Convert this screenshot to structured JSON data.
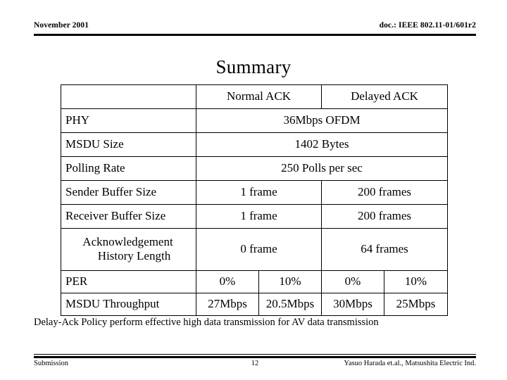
{
  "header": {
    "date": "November 2001",
    "doc_id": "doc.: IEEE 802.11-01/601r2"
  },
  "title": "Summary",
  "table": {
    "column_headers": [
      "",
      "Normal ACK",
      "Delayed ACK"
    ],
    "rows": [
      {
        "label": "PHY",
        "span": "all",
        "values": [
          "36Mbps OFDM"
        ]
      },
      {
        "label": "MSDU Size",
        "span": "all",
        "values": [
          "1402 Bytes"
        ]
      },
      {
        "label": "Polling Rate",
        "span": "all",
        "values": [
          "250 Polls per sec"
        ]
      },
      {
        "label": "Sender Buffer Size",
        "span": "two",
        "values": [
          "1 frame",
          "200 frames"
        ]
      },
      {
        "label": "Receiver Buffer Size",
        "span": "two",
        "values": [
          "1 frame",
          "200 frames"
        ]
      },
      {
        "label_line1": "Acknowledgement",
        "label_line2": "History Length",
        "span": "two",
        "values": [
          "0 frame",
          "64 frames"
        ]
      },
      {
        "label": "PER",
        "span": "four",
        "values": [
          "0%",
          "10%",
          "0%",
          "10%"
        ]
      },
      {
        "label": "MSDU Throughput",
        "span": "four",
        "values": [
          "27Mbps",
          "20.5Mbps",
          "30Mbps",
          "25Mbps"
        ]
      }
    ]
  },
  "conclusion": "Delay-Ack Policy perform effective high data transmission for AV data transmission",
  "footer": {
    "left": "Submission",
    "page": "12",
    "right": "Yasuo Harada et.al., Matsushita Electric Ind."
  },
  "colors": {
    "text": "#000000",
    "background": "#ffffff",
    "rule": "#000000"
  }
}
